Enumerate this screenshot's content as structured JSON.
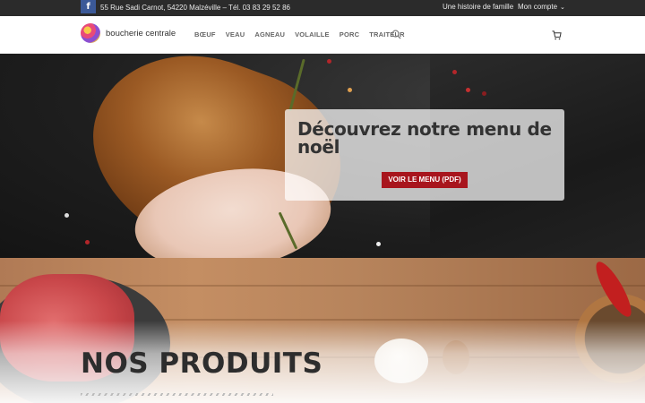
{
  "topbar": {
    "facebook_icon": "facebook-icon",
    "facebook_glyph": "f",
    "address": "55 Rue Sadi Carnot, 54220 Malzéville – Tél. 03 83 29 52 86",
    "history_link": "Une histoire de famille",
    "account_menu": "Mon compte"
  },
  "header": {
    "brand": "boucherie centrale",
    "nav": [
      "BŒUF",
      "VEAU",
      "AGNEAU",
      "VOLAILLE",
      "PORC",
      "TRAITEUR"
    ],
    "icons": [
      "search-icon",
      "cart-icon"
    ]
  },
  "hero": {
    "title": "Découvrez notre menu de noël",
    "button_label": "VOIR LE MENU (PDF)"
  },
  "products": {
    "title": "NOS PRODUITS"
  },
  "colors": {
    "topbar_bg": "#2b2b2b",
    "facebook_blue": "#3b5998",
    "button_red": "#a8151d"
  }
}
